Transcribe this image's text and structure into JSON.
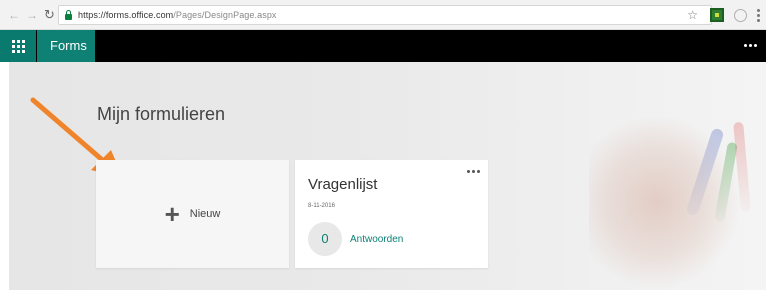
{
  "browser": {
    "url_host": "https://forms.office.com",
    "url_path": "/Pages/DesignPage.aspx",
    "back_icon": "arrow-left",
    "forward_icon": "arrow-right",
    "reload_icon": "refresh",
    "star_icon": "star",
    "menu_icon": "vertical-dots"
  },
  "app": {
    "name": "Forms",
    "launcher_icon": "waffle",
    "more_icon": "horizontal-dots",
    "accent_color": "#0e8074"
  },
  "main": {
    "title": "Mijn formulieren",
    "new_card": {
      "label": "Nieuw",
      "icon": "plus"
    },
    "forms": [
      {
        "title": "Vragenlijst",
        "date": "8-11-2016",
        "responses": "0",
        "responses_label": "Antwoorden"
      }
    ]
  },
  "annotation": {
    "arrow_color": "#f0842b"
  }
}
